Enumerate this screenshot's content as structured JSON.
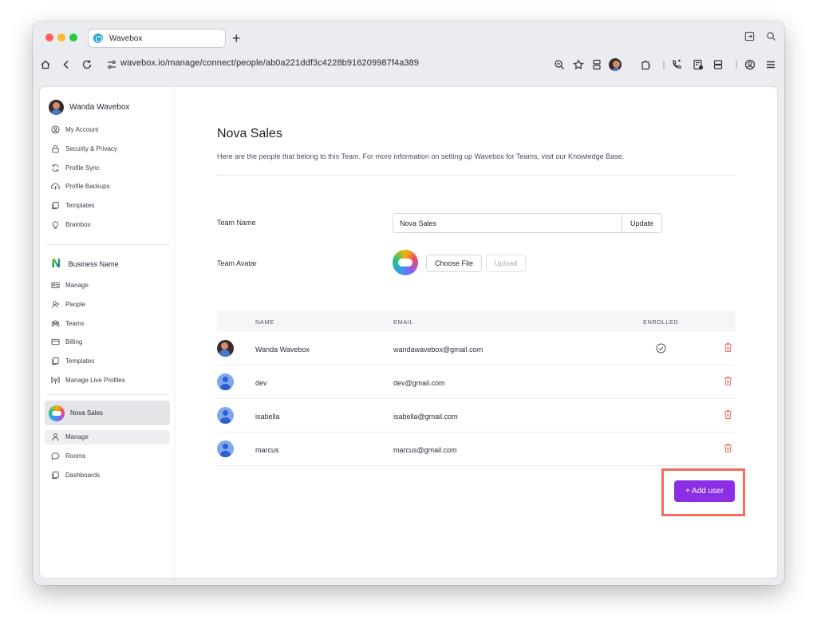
{
  "browser": {
    "tab_title": "Wavebox",
    "new_tab": "+",
    "url": "wavebox.io/manage/connect/people/ab0a221ddf3c4228b916209987f4a389"
  },
  "sidebar": {
    "user_name": "Wanda Wavebox",
    "account_items": [
      {
        "label": "My Account",
        "icon": "user-circle-icon"
      },
      {
        "label": "Security & Privacy",
        "icon": "lock-icon"
      },
      {
        "label": "Profile Sync",
        "icon": "sync-icon"
      },
      {
        "label": "Profile Backups",
        "icon": "cloud-upload-icon"
      },
      {
        "label": "Templates",
        "icon": "templates-icon"
      },
      {
        "label": "Brainbox",
        "icon": "lightbulb-icon"
      }
    ],
    "org_name": "Business Name",
    "org_items": [
      {
        "label": "Manage",
        "icon": "id-card-icon"
      },
      {
        "label": "People",
        "icon": "user-plus-icon"
      },
      {
        "label": "Teams",
        "icon": "users-icon"
      },
      {
        "label": "Billing",
        "icon": "credit-card-icon"
      },
      {
        "label": "Templates",
        "icon": "templates-icon"
      },
      {
        "label": "Manage Live Profiles",
        "icon": "broadcast-icon"
      }
    ],
    "team_name": "Nova Sales",
    "team_items": [
      {
        "label": "Manage",
        "icon": "user-icon"
      },
      {
        "label": "Rooms",
        "icon": "chat-icon"
      },
      {
        "label": "Dashboards",
        "icon": "templates-icon"
      }
    ]
  },
  "main": {
    "title": "Nova Sales",
    "subtitle": "Here are the people that belong to this Team. For more information on setting up Wavebox for Teams, visit our Knowledge Base.",
    "team_name_label": "Team Name",
    "team_name_value": "Nova Sales",
    "update_label": "Update",
    "team_avatar_label": "Team Avatar",
    "choose_file_label": "Choose File",
    "upload_label": "Upload",
    "columns": {
      "name": "NAME",
      "email": "EMAIL",
      "enrolled": "ENROLLED"
    },
    "people": [
      {
        "name": "Wanda Wavebox",
        "email": "wandawavebox@gmail.com",
        "enrolled": true
      },
      {
        "name": "dev",
        "email": "dev@gmail.com",
        "enrolled": false
      },
      {
        "name": "isabella",
        "email": "isabella@gmail.com",
        "enrolled": false
      },
      {
        "name": "marcus",
        "email": "marcus@gmail.com",
        "enrolled": false
      }
    ],
    "add_user_label": "+ Add user"
  },
  "colors": {
    "accent": "#8b2ee6",
    "highlight": "#f26d5b",
    "trash": "#ef6f6f"
  }
}
